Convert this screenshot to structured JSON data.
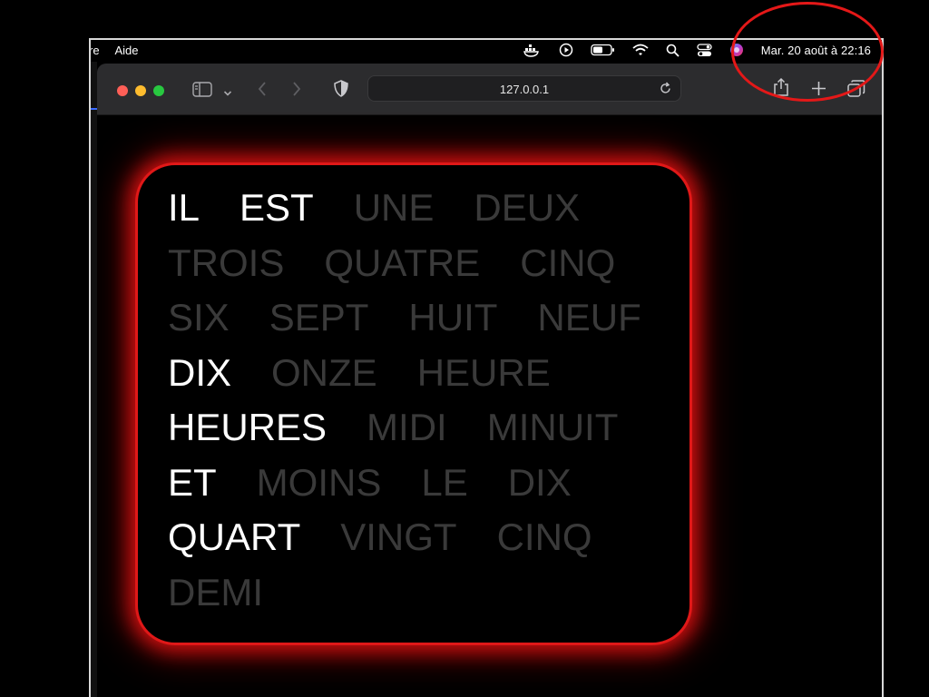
{
  "menubar": {
    "items": [
      "re",
      "Aide"
    ],
    "clock": "Mar. 20 août à 22:16"
  },
  "browser": {
    "url": "127.0.0.1"
  },
  "word_clock": {
    "rows": [
      [
        {
          "text": "IL",
          "lit": true
        },
        {
          "text": "EST",
          "lit": true
        },
        {
          "text": "UNE",
          "lit": false
        },
        {
          "text": "DEUX",
          "lit": false
        }
      ],
      [
        {
          "text": "TROIS",
          "lit": false
        },
        {
          "text": "QUATRE",
          "lit": false
        },
        {
          "text": "CINQ",
          "lit": false
        }
      ],
      [
        {
          "text": "SIX",
          "lit": false
        },
        {
          "text": "SEPT",
          "lit": false
        },
        {
          "text": "HUIT",
          "lit": false
        },
        {
          "text": "NEUF",
          "lit": false
        }
      ],
      [
        {
          "text": "DIX",
          "lit": true
        },
        {
          "text": "ONZE",
          "lit": false
        },
        {
          "text": "HEURE",
          "lit": false
        }
      ],
      [
        {
          "text": "HEURES",
          "lit": true
        },
        {
          "text": "MIDI",
          "lit": false
        },
        {
          "text": "MINUIT",
          "lit": false
        }
      ],
      [
        {
          "text": "ET",
          "lit": true
        },
        {
          "text": "MOINS",
          "lit": false
        },
        {
          "text": "LE",
          "lit": false
        },
        {
          "text": "DIX",
          "lit": false
        }
      ],
      [
        {
          "text": "QUART",
          "lit": true
        },
        {
          "text": "VINGT",
          "lit": false
        },
        {
          "text": "CINQ",
          "lit": false
        }
      ],
      [
        {
          "text": "DEMI",
          "lit": false
        }
      ]
    ]
  },
  "colors": {
    "lit": "#ffffff",
    "unlit": "#3a3a3a",
    "frame_glow": "#e01818",
    "annotation": "#e41818"
  },
  "icons": [
    "docker-icon",
    "play-circle-icon",
    "battery-icon",
    "wifi-icon",
    "search-icon",
    "control-center-icon",
    "siri-icon",
    "sidebar-icon",
    "chevron-down-icon",
    "back-icon",
    "forward-icon",
    "shield-icon",
    "reload-icon",
    "share-icon",
    "new-tab-icon",
    "tabs-overview-icon"
  ]
}
